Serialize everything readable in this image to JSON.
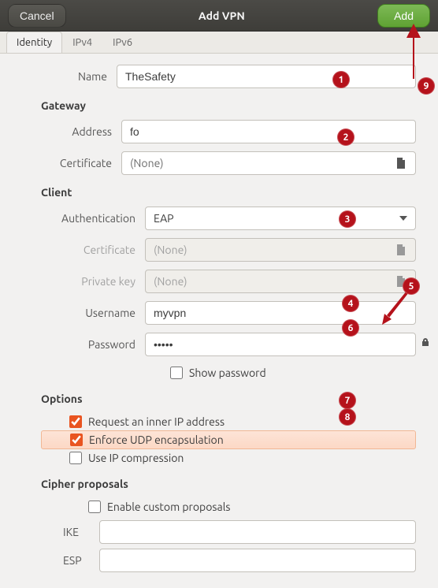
{
  "titlebar": {
    "cancel": "Cancel",
    "title": "Add VPN",
    "add": "Add"
  },
  "tabs": {
    "identity": "Identity",
    "ipv4": "IPv4",
    "ipv6": "IPv6"
  },
  "form": {
    "name_label": "Name",
    "name_value": "TheSafety",
    "gateway_section": "Gateway",
    "address_label": "Address",
    "address_value": "fo",
    "certificate_label": "Certificate",
    "certificate_value": "(None)",
    "client_section": "Client",
    "auth_label": "Authentication",
    "auth_value": "EAP",
    "client_cert_label": "Certificate",
    "client_cert_value": "(None)",
    "pkey_label": "Private key",
    "pkey_value": "(None)",
    "user_label": "Username",
    "user_value": "myvpn",
    "pass_label": "Password",
    "pass_value": "•••••",
    "showpw_label": "Show password",
    "options_section": "Options",
    "opt_inner": "Request an inner IP address",
    "opt_udp": "Enforce UDP encapsulation",
    "opt_comp": "Use IP compression",
    "cipher_section": "Cipher proposals",
    "enable_custom": "Enable custom proposals",
    "ike_label": "IKE",
    "ike_value": "",
    "esp_label": "ESP",
    "esp_value": ""
  },
  "badges": {
    "b1": "1",
    "b2": "2",
    "b3": "3",
    "b4": "4",
    "b5": "5",
    "b6": "6",
    "b7": "7",
    "b8": "8",
    "b9": "9"
  }
}
